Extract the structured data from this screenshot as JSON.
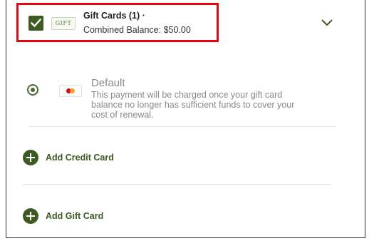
{
  "gift_cards": {
    "icon_text": "GIFT",
    "title": "Gift Cards (1) ·",
    "balance": "Combined Balance: $50.00",
    "checked": true,
    "expand_icon": "chevron-down-icon"
  },
  "default_payment": {
    "title": "Default",
    "description": "This payment will be charged once your gift card balance no longer has sufficient funds to cover your cost of renewal.",
    "selected": true,
    "card_icon": "mastercard-icon"
  },
  "actions": {
    "add_credit_card": "Add Credit Card",
    "add_gift_card": "Add Gift Card"
  },
  "colors": {
    "accent": "#3d5a23",
    "highlight": "#e30613",
    "muted_text": "#8a8a8a"
  }
}
